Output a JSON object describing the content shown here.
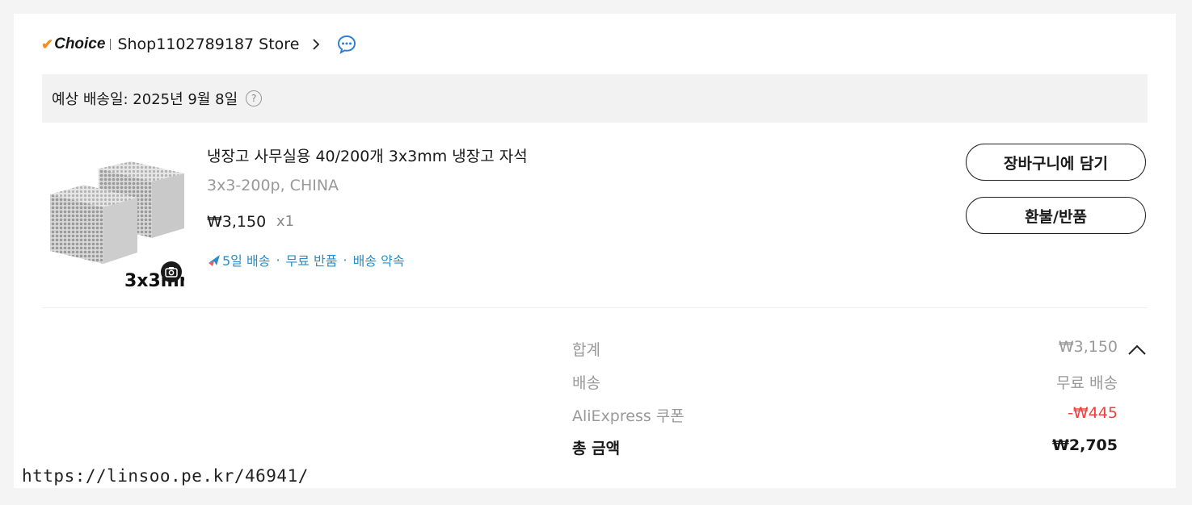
{
  "store": {
    "choice_label": "Choice",
    "name": "Shop1102789187 Store"
  },
  "shipping": {
    "estimate_text": "예상 배송일: 2025년 9월 8일",
    "help_glyph": "?"
  },
  "product": {
    "name": "냉장고 사무실용 40/200개 3x3mm 냉장고 자석",
    "sku": "3x3-200p, CHINA",
    "price": "₩3,150",
    "qty": "x1",
    "image_caption": "3x3mm",
    "badges": [
      "5일 배송",
      "무료 반품",
      "배송 약속"
    ],
    "badge_separator": "·"
  },
  "actions": {
    "add_to_cart": "장바구니에 담기",
    "refund": "환불/반품"
  },
  "summary": {
    "subtotal_label": "합계",
    "subtotal_value": "₩3,150",
    "shipping_label": "배송",
    "shipping_value": "무료 배송",
    "coupon_label": "AliExpress 쿠폰",
    "coupon_value": "-₩445",
    "total_label": "총 금액",
    "total_value": "₩2,705"
  },
  "watermark": "https://linsoo.pe.kr/46941/",
  "colors": {
    "accent_orange": "#fd8a1b",
    "badge_blue": "#2a8dc7",
    "discount_red": "#f0403b",
    "chat_blue": "#2f7fd6"
  },
  "icons": [
    "check-icon",
    "chevron-right-icon",
    "chat-icon",
    "help-icon",
    "camera-icon",
    "plane-icon",
    "chevron-up-icon"
  ]
}
